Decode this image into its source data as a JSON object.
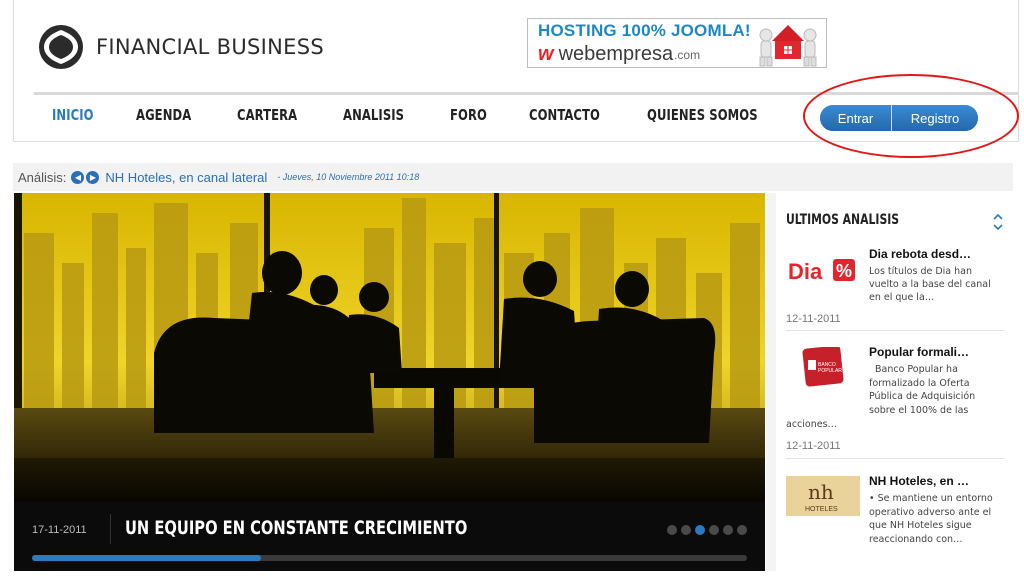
{
  "header": {
    "logo_text": "FINANCIAL BUSINESS",
    "banner": {
      "line1": "HOSTING 100% JOOMLA!",
      "brand_w": "w",
      "brand_name": "webempresa",
      "brand_tld": ".com"
    }
  },
  "nav": {
    "items": [
      {
        "label": "INICIO",
        "active": true
      },
      {
        "label": "AGENDA"
      },
      {
        "label": "CARTERA"
      },
      {
        "label": "ANALISIS"
      },
      {
        "label": "FORO"
      },
      {
        "label": "CONTACTO"
      },
      {
        "label": "QUIENES SOMOS"
      }
    ]
  },
  "auth": {
    "login_label": "Entrar",
    "register_label": "Registro"
  },
  "ticker": {
    "label": "Análisis:",
    "headline": "NH Hoteles, en canal lateral",
    "date": "- Jueves, 10 Noviembre 2011 10:18"
  },
  "slider": {
    "date": "17-11-2011",
    "title": "UN EQUIPO EN CONSTANTE CRECIMIENTO",
    "dot_count": 6,
    "active_dot": 2,
    "progress_fraction": 0.32
  },
  "sidebar": {
    "title": "ULTIMOS ANALISIS",
    "articles": [
      {
        "thumb_text": "Dia %",
        "title": "Dia rebota desd…",
        "body": [
          "Los títulos de Dia han",
          "vuelto a la base del canal",
          "en el que la…"
        ],
        "date": "12-11-2011"
      },
      {
        "thumb_text": "BANCO POPULAR",
        "title": "Popular formali…",
        "body": [
          "Banco Popular ha",
          "formalizado la Oferta",
          "Pública de Adquisición",
          "sobre el 100% de las",
          "acciones…"
        ],
        "date": "12-11-2011"
      },
      {
        "thumb_text": "NH HOTELES",
        "title": "NH Hoteles, en …",
        "body": [
          "• Se mantiene un entorno",
          "operativo adverso ante el",
          "que NH Hoteles sigue",
          "reaccionando con…"
        ]
      }
    ]
  },
  "colors": {
    "accent_blue": "#2a7bc0",
    "annotation_red": "#e01818",
    "dia_red": "#e3262d",
    "popular_red": "#c8202a",
    "nh_gold": "#e9d39a"
  }
}
